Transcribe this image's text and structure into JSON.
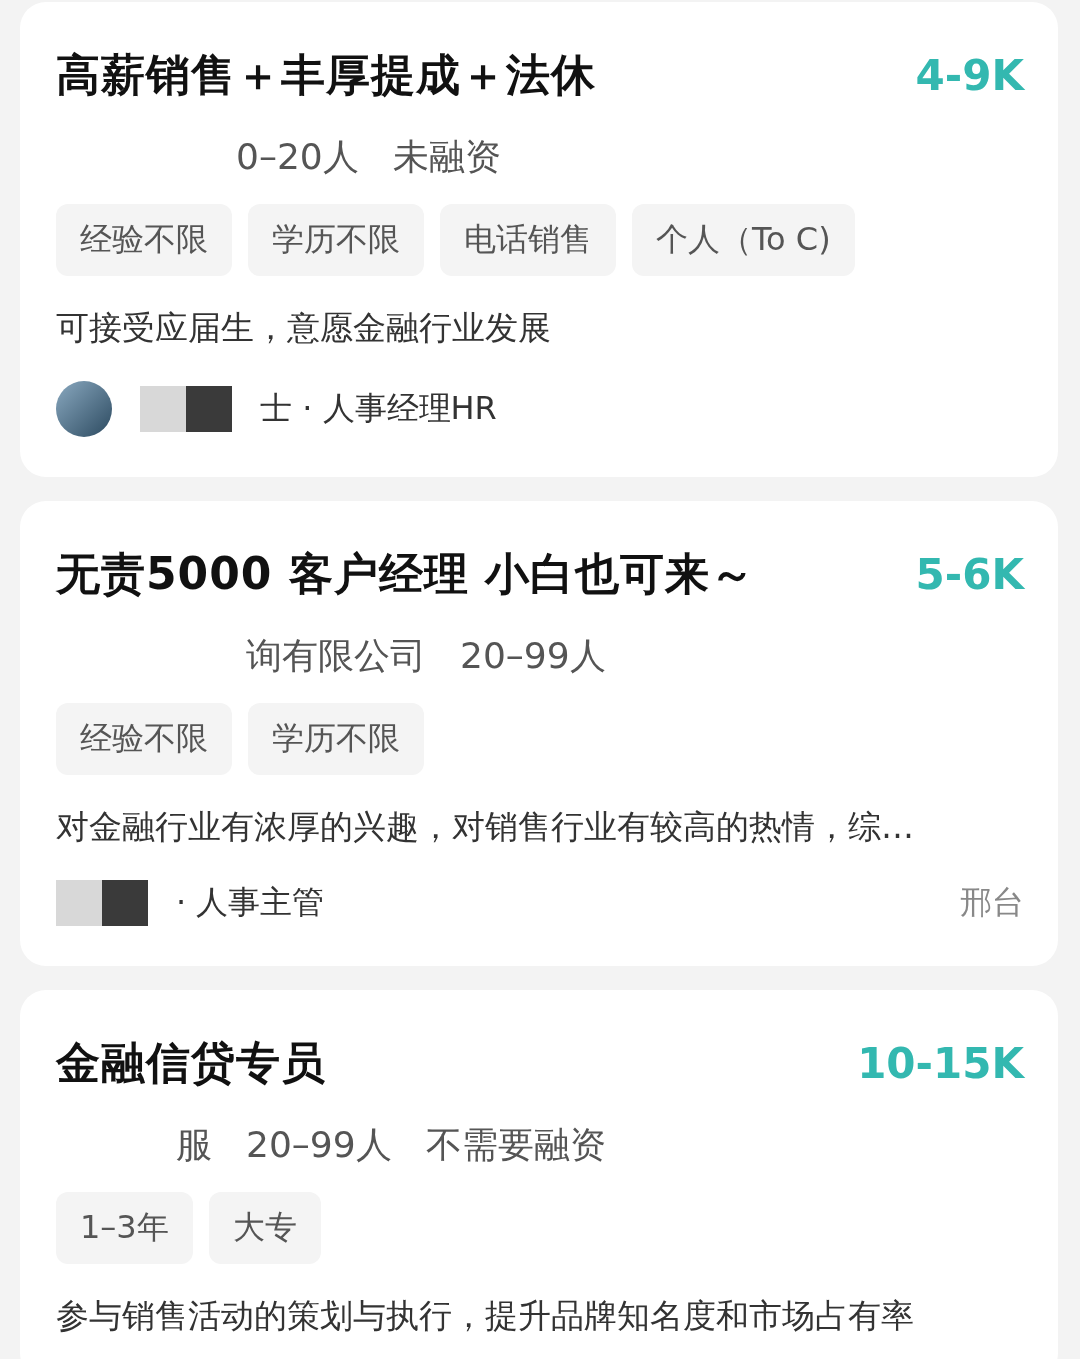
{
  "jobs": [
    {
      "title": "高薪销售＋丰厚提成＋法休",
      "salary": "4-9K",
      "company_info": [
        "0–20人",
        "未融资"
      ],
      "tags": [
        "经验不限",
        "学历不限",
        "电话销售",
        "个人（To C)"
      ],
      "description": "可接受应届生，意愿金融行业发展",
      "recruiter": {
        "avatar": true,
        "text": "士 · 人事经理HR"
      }
    },
    {
      "title": "无责5000 客户经理 小白也可来～",
      "salary": "5-6K",
      "company_info": [
        "询有限公司",
        "20–99人"
      ],
      "tags": [
        "经验不限",
        "学历不限"
      ],
      "description": "对金融行业有浓厚的兴趣，对销售行业有较高的热情，综…",
      "recruiter": {
        "avatar": false,
        "text": "· 人事主管",
        "location": "邢台"
      }
    },
    {
      "title": "金融信贷专员",
      "salary": "10-15K",
      "company_info": [
        "服",
        "20–99人",
        "不需要融资"
      ],
      "tags": [
        "1–3年",
        "大专"
      ],
      "description": "参与销售活动的策划与执行，提升品牌知名度和市场占有率"
    }
  ]
}
